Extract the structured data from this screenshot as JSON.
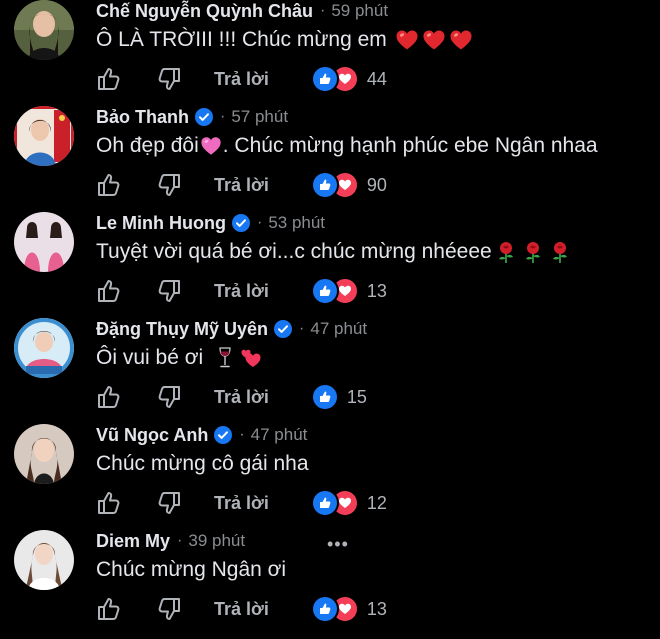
{
  "ui": {
    "reply_label": "Trả lời",
    "dot_separator": "·",
    "more_label": "•••"
  },
  "colors": {
    "background": "#000000",
    "text_primary": "#e4e6eb",
    "text_secondary": "#8a8d91",
    "like_blue": "#1877f2",
    "love_red": "#f33e58",
    "verified_blue": "#1877f2"
  },
  "comments": [
    {
      "name": "Chế Nguyễn Quỳnh Châu",
      "verified": false,
      "time": "59 phút",
      "text": "Ô LÀ TRỜIII !!! Chúc mừng em",
      "emojis": [
        "red-heart",
        "red-heart",
        "red-heart"
      ],
      "reactions": [
        "like",
        "love"
      ],
      "reaction_count": "44"
    },
    {
      "name": "Bảo Thanh",
      "verified": true,
      "time": "57 phút",
      "text_before": "Oh đẹp đôi",
      "emoji_mid": "pink-heart",
      "text_after": ". Chúc mừng hạnh phúc ebe Ngân nhaa",
      "reactions": [
        "like",
        "love"
      ],
      "reaction_count": "90"
    },
    {
      "name": "Le Minh Huong",
      "verified": true,
      "time": "53 phút",
      "text": "Tuyệt vời quá bé ơi...c chúc mừng nhéeee",
      "emojis": [
        "rose",
        "rose",
        "rose"
      ],
      "reactions": [
        "like",
        "love"
      ],
      "reaction_count": "13"
    },
    {
      "name": "Đặng Thụy Mỹ Uyên",
      "verified": true,
      "time": "47 phút",
      "text": "Ôi vui bé ơi",
      "emojis": [
        "wine-glass",
        "two-hearts"
      ],
      "reactions": [
        "like"
      ],
      "reaction_count": "15"
    },
    {
      "name": "Vũ Ngọc Anh",
      "verified": true,
      "time": "47 phút",
      "text": "Chúc mừng cô gái nha",
      "emojis": [],
      "reactions": [
        "like",
        "love"
      ],
      "reaction_count": "12"
    },
    {
      "name": "Diem My",
      "verified": false,
      "time": "39 phút",
      "text": "Chúc mừng Ngân ơi",
      "emojis": [],
      "reactions": [
        "like",
        "love"
      ],
      "reaction_count": "13",
      "has_more_button": true
    }
  ]
}
